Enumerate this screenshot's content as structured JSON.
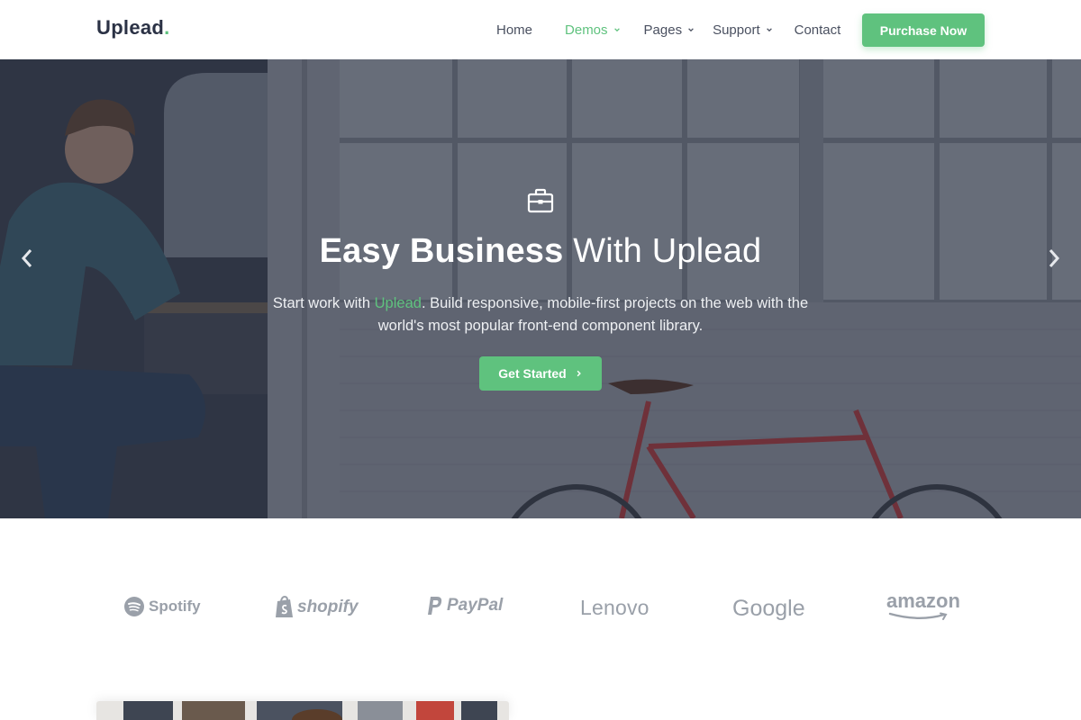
{
  "brand": {
    "name": "Uplead",
    "dot": ".",
    "accent": "#5fc27e"
  },
  "nav": {
    "items": [
      {
        "label": "Home",
        "has_dropdown": false,
        "active": false
      },
      {
        "label": "Demos",
        "has_dropdown": true,
        "active": true
      },
      {
        "label": "Pages",
        "has_dropdown": true,
        "active": false
      },
      {
        "label": "Support",
        "has_dropdown": true,
        "active": false
      },
      {
        "label": "Contact",
        "has_dropdown": false,
        "active": false
      }
    ],
    "cta_label": "Purchase Now"
  },
  "hero": {
    "icon": "briefcase-icon",
    "title_bold": "Easy Business",
    "title_light": "With Uplead",
    "subtitle_prefix": "Start work with ",
    "subtitle_brand": "Uplead",
    "subtitle_suffix": ". Build responsive, mobile-first projects on the web with the world's most popular front-end component library.",
    "cta_label": "Get Started",
    "prev_icon": "chevron-left-icon",
    "next_icon": "chevron-right-icon"
  },
  "logos": {
    "items": [
      {
        "name": "Spotify"
      },
      {
        "name": "shopify"
      },
      {
        "name": "PayPal"
      },
      {
        "name": "Lenovo"
      },
      {
        "name": "Google"
      },
      {
        "name": "amazon"
      }
    ],
    "color": "#9aa0a9"
  }
}
